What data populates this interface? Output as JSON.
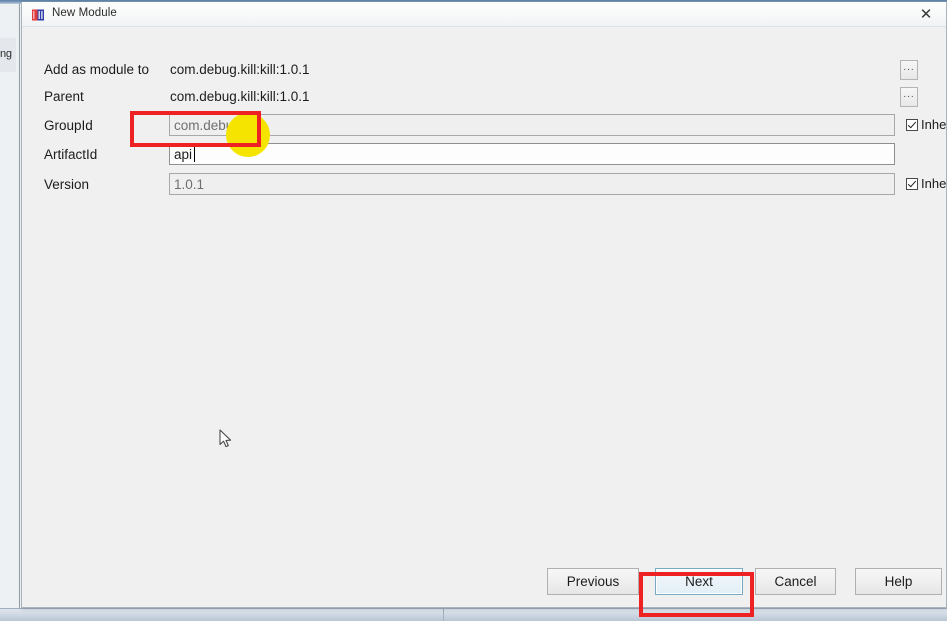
{
  "window": {
    "title": "New Module",
    "icon": "module-icon",
    "close_label": "✕"
  },
  "background": {
    "left_tab_text": "ng"
  },
  "form": {
    "rows": [
      {
        "label": "Add as module to",
        "type": "static",
        "value": "com.debug.kill:kill:1.0.1",
        "browse": "...",
        "browse_icon": "ellipsis-icon"
      },
      {
        "label": "Parent",
        "type": "static",
        "value": "com.debug.kill:kill:1.0.1",
        "browse": "...",
        "browse_icon": "ellipsis-icon"
      },
      {
        "label": "GroupId",
        "type": "input",
        "value": "com.debug.kill",
        "state": "disabled",
        "inherit_label": "Inherit",
        "inherit_checked": true
      },
      {
        "label": "ArtifactId",
        "type": "input",
        "value": "api",
        "state": "active",
        "focused": true
      },
      {
        "label": "Version",
        "type": "input",
        "value": "1.0.1",
        "state": "disabled",
        "inherit_label": "Inherit",
        "inherit_checked": true
      }
    ]
  },
  "footer": {
    "buttons": [
      {
        "label": "Previous",
        "style": "normal"
      },
      {
        "label": "Next",
        "style": "default"
      },
      {
        "label": "Cancel",
        "style": "normal"
      },
      {
        "label": "Help",
        "style": "normal"
      }
    ]
  },
  "annotations": {
    "highlight_color": "#ee2222",
    "click_marker_color": "#f5e400",
    "boxes": [
      {
        "target": "artifactid-field"
      },
      {
        "target": "next-button"
      }
    ]
  }
}
